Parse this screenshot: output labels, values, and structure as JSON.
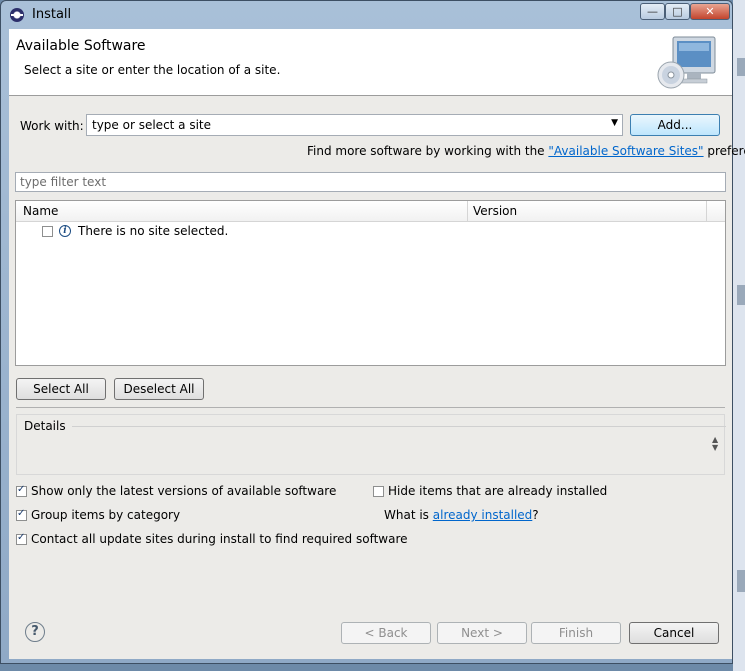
{
  "window": {
    "title": "Install"
  },
  "banner": {
    "title": "Available Software",
    "description": "Select a site or enter the location of a site."
  },
  "work_with": {
    "label": "Work with:",
    "value": "type or select a site",
    "add_button": "Add..."
  },
  "find_more": {
    "prefix": "Find more software by working with the ",
    "link": "\"Available Software Sites\"",
    "suffix": " preferences."
  },
  "filter": {
    "placeholder": "type filter text"
  },
  "tree": {
    "columns": [
      "Name",
      "Version"
    ],
    "rows": [
      {
        "checked": false,
        "icon": "info-icon",
        "text": "There is no site selected."
      }
    ]
  },
  "selection_buttons": {
    "select_all": "Select All",
    "deselect_all": "Deselect All"
  },
  "details": {
    "label": "Details"
  },
  "options": {
    "show_latest": {
      "label": "Show only the latest versions of available software",
      "checked": true
    },
    "group_items": {
      "label": "Group items by category",
      "checked": true
    },
    "contact_sites": {
      "label": "Contact all update sites during install to find required software",
      "checked": true
    },
    "hide_installed": {
      "label": "Hide items that are already installed",
      "checked": false
    },
    "what_is": {
      "prefix": "What is ",
      "link": "already installed",
      "suffix": "?"
    }
  },
  "footer": {
    "help_icon": "help-icon",
    "back": "< Back",
    "next": "Next >",
    "finish": "Finish",
    "cancel": "Cancel"
  },
  "colors": {
    "link": "#0066cc",
    "titlebar": "#a9c0d8",
    "dialog_bg": "#ecebe8"
  }
}
